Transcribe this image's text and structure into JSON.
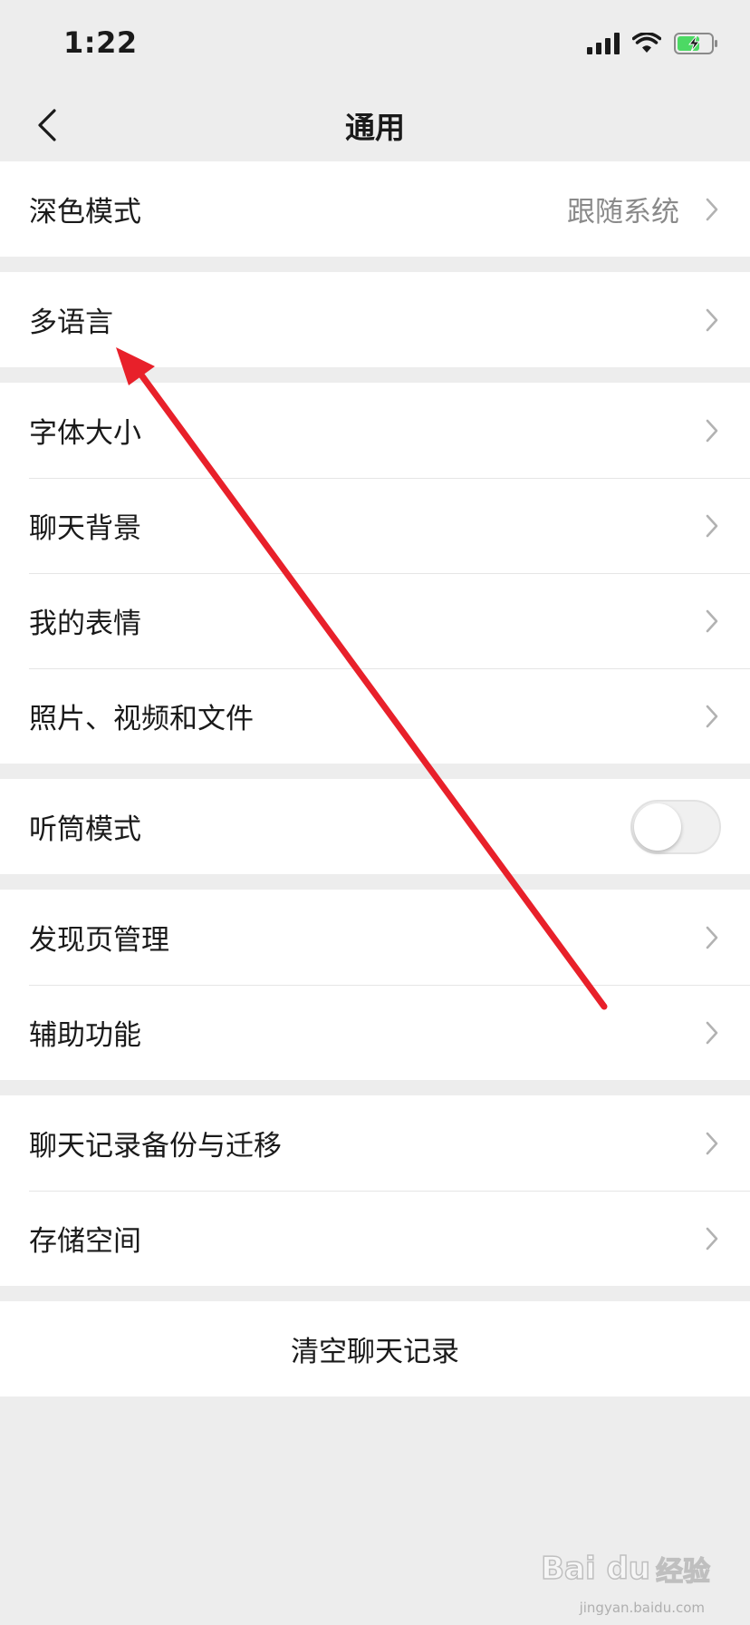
{
  "status_bar": {
    "time": "1:22"
  },
  "nav": {
    "title": "通用"
  },
  "groups": [
    {
      "rows": [
        {
          "label": "深色模式",
          "value": "跟随系统"
        }
      ]
    },
    {
      "rows": [
        {
          "label": "多语言"
        }
      ]
    },
    {
      "rows": [
        {
          "label": "字体大小"
        },
        {
          "label": "聊天背景"
        },
        {
          "label": "我的表情"
        },
        {
          "label": "照片、视频和文件"
        }
      ]
    },
    {
      "rows": [
        {
          "label": "听筒模式",
          "toggle": false
        }
      ]
    },
    {
      "rows": [
        {
          "label": "发现页管理"
        },
        {
          "label": "辅助功能"
        }
      ]
    },
    {
      "rows": [
        {
          "label": "聊天记录备份与迁移"
        },
        {
          "label": "存储空间"
        }
      ]
    },
    {
      "rows": [
        {
          "label": "清空聊天记录"
        }
      ]
    }
  ],
  "annotation": {
    "color": "#e8202a"
  },
  "watermark": {
    "logo": "Bai du",
    "text": "经验",
    "sub": "jingyan.baidu.com"
  }
}
